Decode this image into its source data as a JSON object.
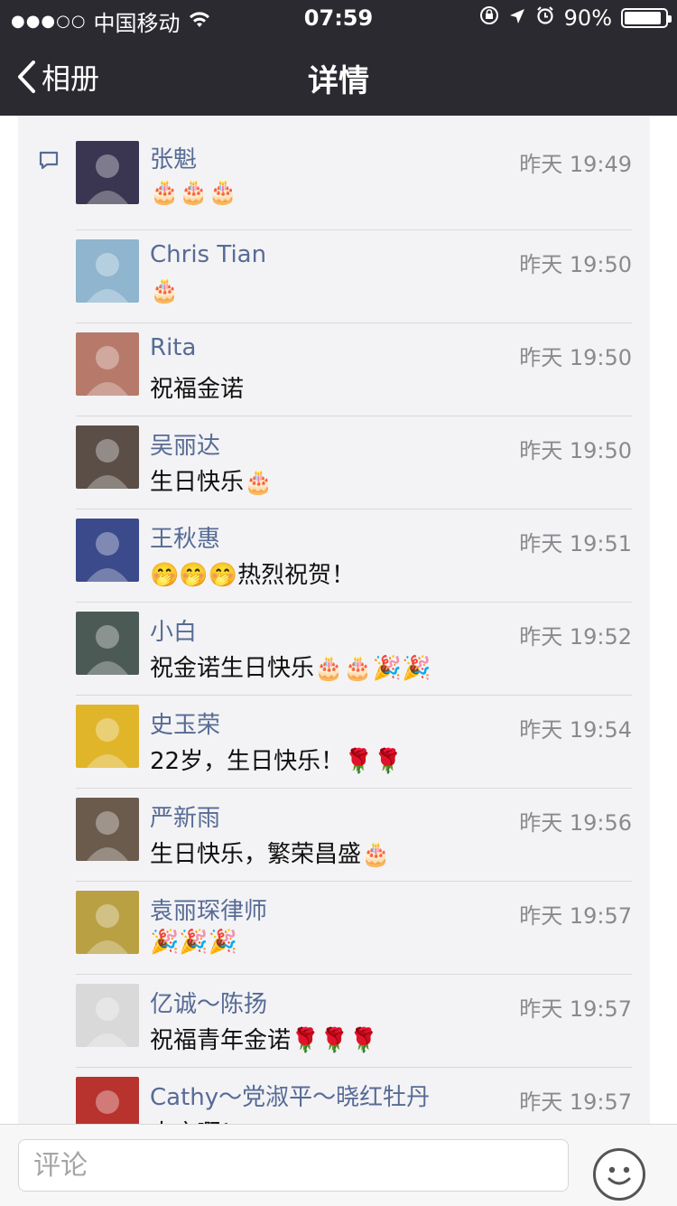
{
  "status_bar": {
    "signal": "●●●○○",
    "carrier": "中国移动",
    "time": "07:59",
    "battery": "90%"
  },
  "nav": {
    "back_label": "相册",
    "title": "详情"
  },
  "comments": [
    {
      "name": "张魁",
      "time": "昨天 19:49",
      "text": "🎂🎂🎂",
      "avatar_color": "#3a3550"
    },
    {
      "name": "Chris Tian",
      "time": "昨天 19:50",
      "text": "🎂",
      "avatar_color": "#8fb5cf"
    },
    {
      "name": "Rita",
      "time": "昨天 19:50",
      "text": "祝福金诺",
      "avatar_color": "#b77a6a"
    },
    {
      "name": "吴丽达",
      "time": "昨天 19:50",
      "text": "生日快乐🎂",
      "avatar_color": "#5a4e47"
    },
    {
      "name": "王秋惠",
      "time": "昨天 19:51",
      "text": "🤭🤭🤭热烈祝贺！",
      "avatar_color": "#3b4a8a"
    },
    {
      "name": "小白",
      "time": "昨天 19:52",
      "text": "祝金诺生日快乐🎂🎂🎉🎉",
      "avatar_color": "#4c5a55"
    },
    {
      "name": "史玉荣",
      "time": "昨天 19:54",
      "text": "22岁，生日快乐！🌹🌹",
      "avatar_color": "#e1b52a"
    },
    {
      "name": "严新雨",
      "time": "昨天 19:56",
      "text": "生日快乐，繁荣昌盛🎂",
      "avatar_color": "#6b5b4d"
    },
    {
      "name": "袁丽琛律师",
      "time": "昨天 19:57",
      "text": "🎉🎉🎉",
      "avatar_color": "#b9a042"
    },
    {
      "name": "亿诚～陈扬",
      "time": "昨天 19:57",
      "text": "祝福青年金诺🌹🌹🌹",
      "avatar_color": "#d9d9d9"
    },
    {
      "name": "Cathy～党淑平～晓红牡丹",
      "time": "昨天 19:57",
      "text": "大庆啊！",
      "avatar_color": "#b8332e"
    }
  ],
  "input": {
    "placeholder": "评论"
  },
  "colors": {
    "nav_bg": "#2b2a30",
    "name_blue": "#576b95",
    "panel_bg": "#f3f3f5"
  },
  "icons": {
    "back": "chevron-left-icon",
    "comment": "comment-icon",
    "emoji": "emoji-smiley-icon"
  }
}
